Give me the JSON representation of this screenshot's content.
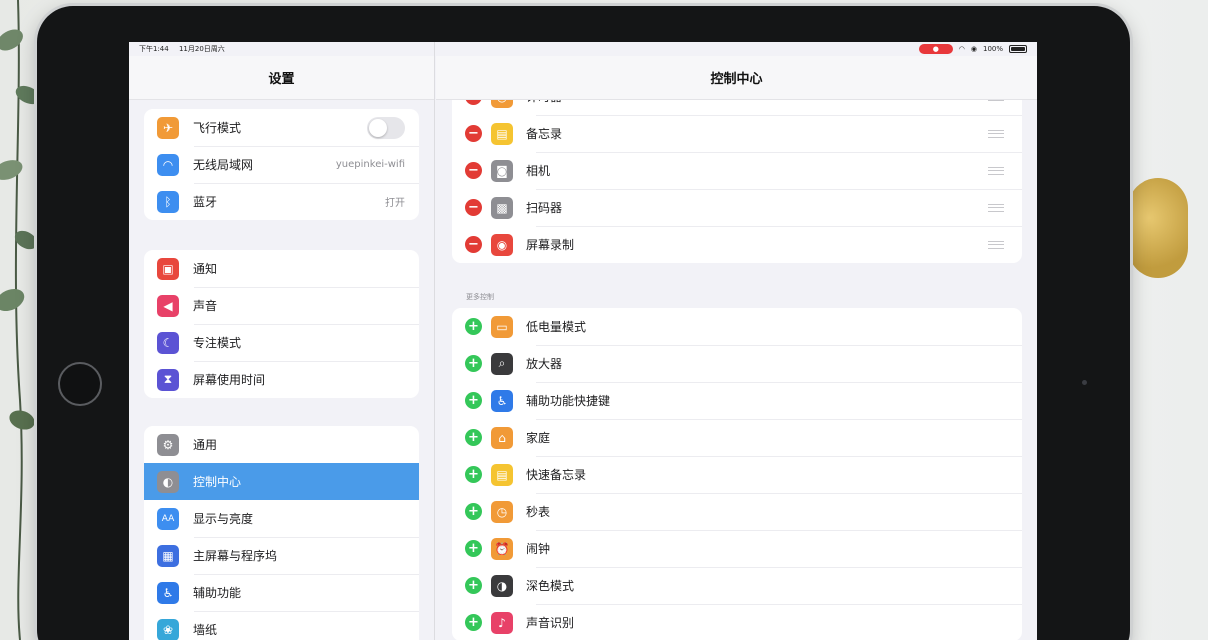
{
  "statusbar": {
    "time": "下午1:44",
    "date": "11月20日周六",
    "battery": "100%"
  },
  "sidebar": {
    "title": "设置",
    "groups": [
      {
        "items": [
          {
            "label": "飞行模式",
            "icon": "airplane-icon",
            "color": "#f19a37",
            "control": "toggle"
          },
          {
            "label": "无线局域网",
            "icon": "wifi-icon",
            "color": "#3d8ef0",
            "value": "yuepinkei-wifi"
          },
          {
            "label": "蓝牙",
            "icon": "bluetooth-icon",
            "color": "#3d8ef0",
            "value": "打开"
          }
        ]
      },
      {
        "items": [
          {
            "label": "通知",
            "icon": "notification-icon",
            "color": "#e8473d"
          },
          {
            "label": "声音",
            "icon": "sound-icon",
            "color": "#e84168"
          },
          {
            "label": "专注模式",
            "icon": "moon-icon",
            "color": "#5b53d4"
          },
          {
            "label": "屏幕使用时间",
            "icon": "hourglass-icon",
            "color": "#5b53d4"
          }
        ]
      },
      {
        "items": [
          {
            "label": "通用",
            "icon": "gear-icon",
            "color": "#8e8e93"
          },
          {
            "label": "控制中心",
            "icon": "control-center-icon",
            "color": "#8e8e93",
            "selected": true
          },
          {
            "label": "显示与亮度",
            "icon": "display-brightness-icon",
            "color": "#3d8ef0"
          },
          {
            "label": "主屏幕与程序坞",
            "icon": "home-screen-icon",
            "color": "#3d6fe0"
          },
          {
            "label": "辅助功能",
            "icon": "accessibility-icon",
            "color": "#2f7ae8"
          },
          {
            "label": "墙纸",
            "icon": "wallpaper-icon",
            "color": "#36a7d9"
          }
        ]
      }
    ]
  },
  "detail": {
    "title": "控制中心",
    "included": [
      {
        "label": "计时器",
        "icon": "timer-icon",
        "color": "#f19a37"
      },
      {
        "label": "备忘录",
        "icon": "notes-icon",
        "color": "#f5c431"
      },
      {
        "label": "相机",
        "icon": "camera-icon",
        "color": "#8e8e93"
      },
      {
        "label": "扫码器",
        "icon": "qr-scanner-icon",
        "color": "#8e8e93"
      },
      {
        "label": "屏幕录制",
        "icon": "screen-record-icon",
        "color": "#e8473d"
      }
    ],
    "more_header": "更多控制",
    "more": [
      {
        "label": "低电量模式",
        "icon": "battery-icon",
        "color": "#f19a37"
      },
      {
        "label": "放大器",
        "icon": "magnifier-icon",
        "color": "#3a3a3c"
      },
      {
        "label": "辅助功能快捷键",
        "icon": "accessibility-shortcut-icon",
        "color": "#2f7ae8"
      },
      {
        "label": "家庭",
        "icon": "home-icon",
        "color": "#f19a37"
      },
      {
        "label": "快速备忘录",
        "icon": "quick-note-icon",
        "color": "#f5c431"
      },
      {
        "label": "秒表",
        "icon": "stopwatch-icon",
        "color": "#f19a37"
      },
      {
        "label": "闹钟",
        "icon": "alarm-icon",
        "color": "#f19a37"
      },
      {
        "label": "深色模式",
        "icon": "dark-mode-icon",
        "color": "#3a3a3c"
      },
      {
        "label": "声音识别",
        "icon": "sound-recognition-icon",
        "color": "#e84168"
      }
    ]
  }
}
